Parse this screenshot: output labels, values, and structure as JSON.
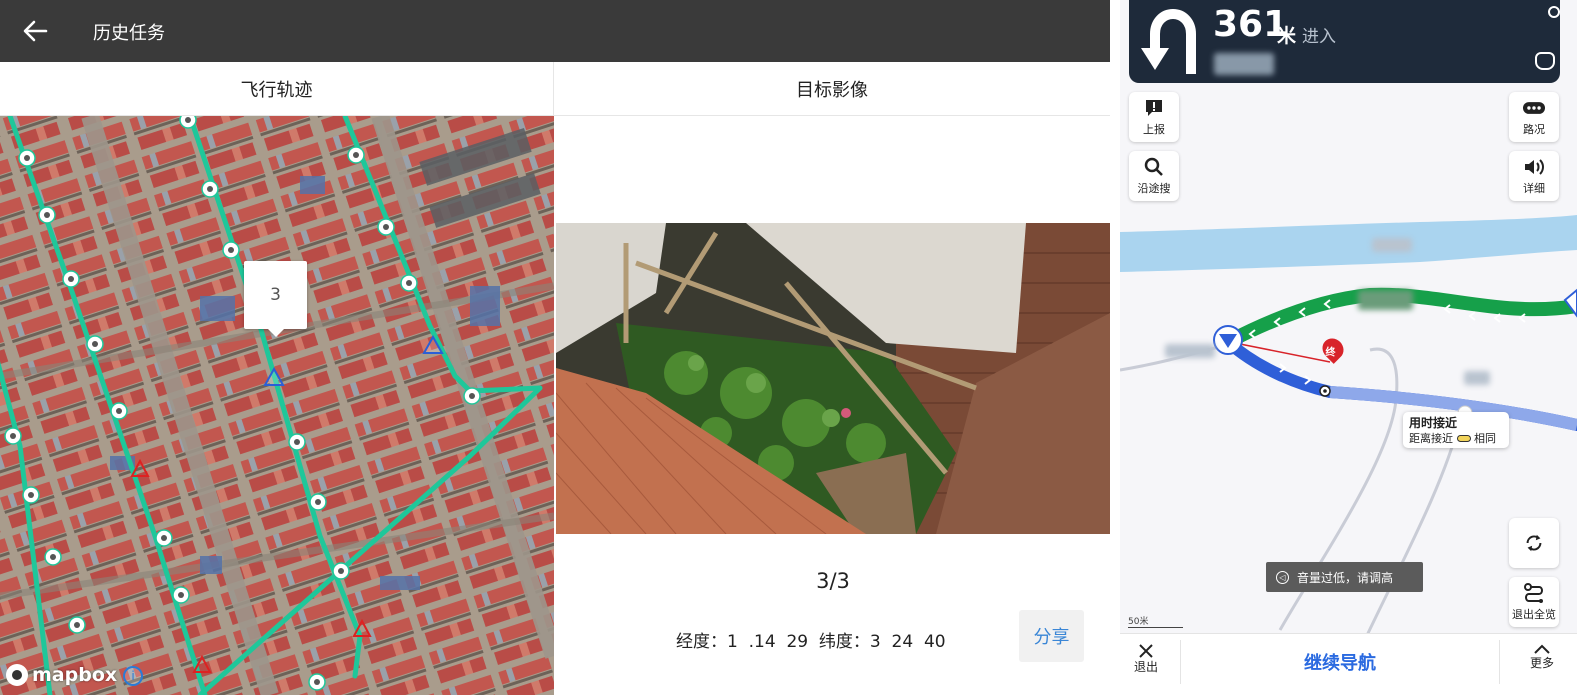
{
  "left_app": {
    "title": "历史任务",
    "tabs": [
      "飞行轨迹",
      "目标影像"
    ],
    "map": {
      "marker_label": "3",
      "attribution": "mapbox",
      "info_button": "i"
    },
    "image_panel": {
      "counter": "3/3",
      "longitude_label": "经度：",
      "longitude_value": "1  .14  29",
      "latitude_label": "纬度：",
      "latitude_value": "3  24  40",
      "share_label": "分享"
    }
  },
  "nav_app": {
    "distance": "361",
    "distance_unit": "米",
    "action": "进入",
    "side_buttons": {
      "report": "上报",
      "search_along": "沿途搜",
      "traffic": "路况",
      "detail": "详细",
      "exit_overview": "退出全览"
    },
    "route_card": {
      "title": "用时接近",
      "subtitle_prefix": "距离接近",
      "subtitle_suffix": "相同"
    },
    "end_marker": "终",
    "toast": "音量过低，请调高",
    "scale_label": "50米",
    "bottom_bar": {
      "exit": "退出",
      "continue": "继续导航",
      "more": "更多"
    }
  },
  "colors": {
    "topbar": "#3a3a3a",
    "track": "#1fc79a",
    "nav_header": "#1e2a3a",
    "route_green": "#16a04a",
    "route_blue": "#2f5fd8",
    "river": "#aad4ef",
    "accent_blue": "#2a6ae0"
  }
}
